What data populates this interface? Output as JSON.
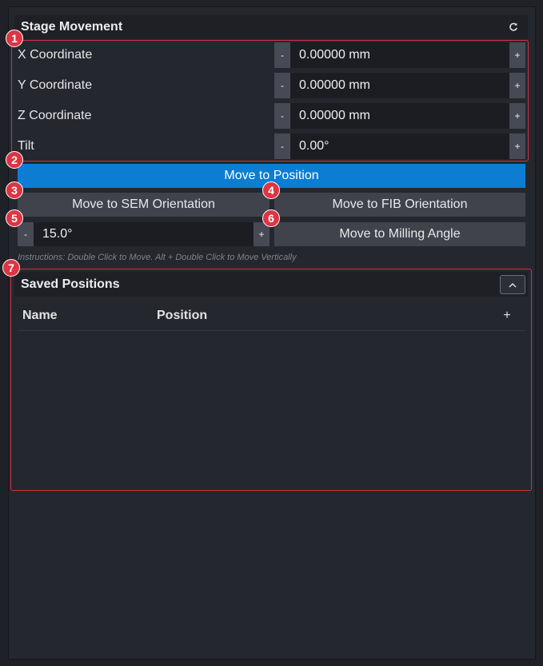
{
  "stage": {
    "title": "Stage Movement",
    "refresh_icon": "refresh-icon",
    "coords": [
      {
        "label": "X Coordinate",
        "value": "0.00000 mm"
      },
      {
        "label": "Y Coordinate",
        "value": "0.00000 mm"
      },
      {
        "label": "Z Coordinate",
        "value": "0.00000 mm"
      },
      {
        "label": "Tilt",
        "value": "0.00°"
      }
    ],
    "minus": "-",
    "plus": "+",
    "move_to_position": "Move to Position",
    "move_sem": "Move to SEM Orientation",
    "move_fib": "Move to FIB Orientation",
    "milling_angle": "15.0°",
    "move_milling": "Move to Milling Angle",
    "instructions": "Instructions: Double Click to Move. Alt + Double Click to Move Vertically"
  },
  "saved": {
    "title": "Saved Positions",
    "columns": [
      "Name",
      "Position"
    ],
    "add": "+",
    "rows": []
  },
  "badges": [
    "1",
    "2",
    "3",
    "4",
    "5",
    "6",
    "7"
  ],
  "colors": {
    "accent": "#0c7dd1",
    "annotation": "#dd3543",
    "background": "#25272e"
  }
}
